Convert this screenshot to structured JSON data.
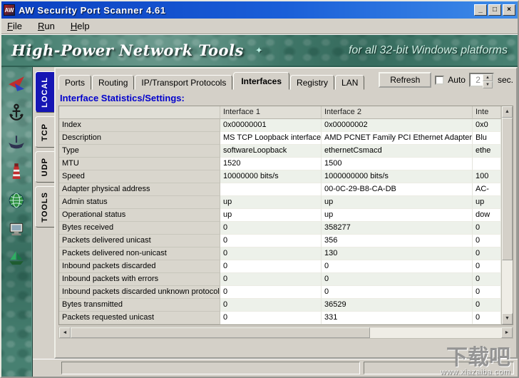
{
  "window": {
    "title": "AW Security Port Scanner 4.61",
    "icon_text": "AW",
    "minimize_glyph": "_",
    "maximize_glyph": "□",
    "close_glyph": "×"
  },
  "menu": {
    "items": [
      "File",
      "Run",
      "Help"
    ]
  },
  "banner": {
    "title": "High-Power Network Tools",
    "sparkle_glyph": "✦",
    "subtitle": "for all 32-bit Windows platforms"
  },
  "sidebar_icons": [
    "glider-icon",
    "anchor-icon",
    "rowboat-icon",
    "lighthouse-icon",
    "globe-icon",
    "computer-icon",
    "sailboat-icon"
  ],
  "side_tabs": [
    "LOCAL",
    "TCP",
    "UDP",
    "TOOLS"
  ],
  "active_side_tab": "LOCAL",
  "top_tabs": [
    "Ports",
    "Routing",
    "IP/Transport Protocols",
    "Interfaces",
    "Registry",
    "LAN"
  ],
  "active_top_tab": "Interfaces",
  "toolbar": {
    "refresh_label": "Refresh",
    "auto_label": "Auto",
    "auto_checked": false,
    "interval_value": "2",
    "sec_label": "sec.",
    "spin_up_glyph": "▲",
    "spin_down_glyph": "▼"
  },
  "section_title": "Interface Statistics/Settings:",
  "table": {
    "columns": [
      "",
      "Interface 1",
      "Interface 2",
      "Inte"
    ],
    "rows": [
      {
        "label": "Index",
        "v1": "0x00000001",
        "v2": "0x00000002",
        "v3": "0x0"
      },
      {
        "label": "Description",
        "v1": "MS TCP Loopback interface",
        "v2": "AMD PCNET Family PCI Ethernet Adapter",
        "v3": "Blu"
      },
      {
        "label": "Type",
        "v1": "softwareLoopback",
        "v2": "ethernetCsmacd",
        "v3": "ethe"
      },
      {
        "label": "MTU",
        "v1": "1520",
        "v2": "1500",
        "v3": ""
      },
      {
        "label": "Speed",
        "v1": "10000000 bits/s",
        "v2": "1000000000 bits/s",
        "v3": "100"
      },
      {
        "label": "Adapter physical address",
        "v1": "",
        "v2": "00-0C-29-B8-CA-DB",
        "v3": "AC-"
      },
      {
        "label": "Admin status",
        "v1": "up",
        "v2": "up",
        "v3": "up"
      },
      {
        "label": "Operational status",
        "v1": "up",
        "v2": "up",
        "v3": "dow"
      },
      {
        "label": "Bytes received",
        "v1": "0",
        "v2": "358277",
        "v3": "0"
      },
      {
        "label": "Packets delivered unicast",
        "v1": "0",
        "v2": "356",
        "v3": "0"
      },
      {
        "label": "Packets delivered non-unicast",
        "v1": "0",
        "v2": "130",
        "v3": "0"
      },
      {
        "label": "Inbound packets discarded",
        "v1": "0",
        "v2": "0",
        "v3": "0"
      },
      {
        "label": "Inbound packets with errors",
        "v1": "0",
        "v2": "0",
        "v3": "0"
      },
      {
        "label": "Inbound packets discarded unknown protocols",
        "v1": "0",
        "v2": "0",
        "v3": "0"
      },
      {
        "label": "Bytes transmitted",
        "v1": "0",
        "v2": "36529",
        "v3": "0"
      },
      {
        "label": "Packets requested unicast",
        "v1": "0",
        "v2": "331",
        "v3": "0"
      }
    ]
  },
  "scrollbars": {
    "up_glyph": "▲",
    "down_glyph": "▼",
    "left_glyph": "◄",
    "right_glyph": "►"
  },
  "statusbar": {
    "pane1": "",
    "pane2": ""
  },
  "watermark": {
    "title": "下载吧",
    "url": "www.xiazaiba.com"
  }
}
